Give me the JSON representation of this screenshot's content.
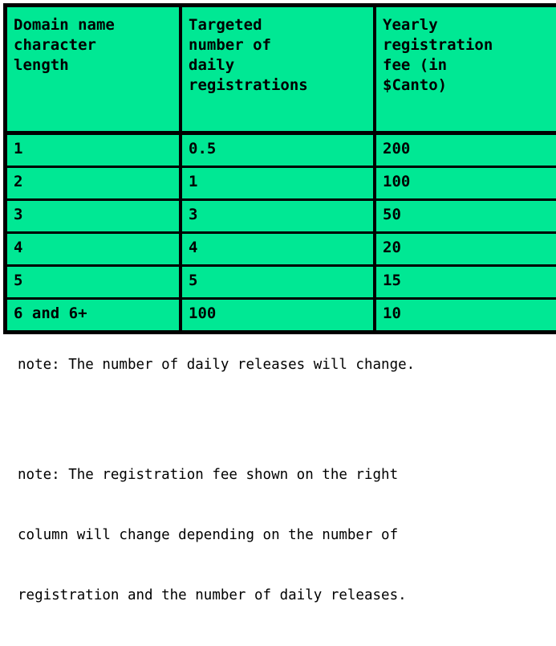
{
  "colors": {
    "cell_background": "#00e894",
    "border": "#000000",
    "text": "#000000",
    "page_background": "#ffffff"
  },
  "table": {
    "headers": [
      {
        "lines": [
          "Domain name",
          "character",
          "length"
        ]
      },
      {
        "lines": [
          "Targeted",
          "number of",
          "daily",
          "registrations"
        ]
      },
      {
        "lines": [
          "Yearly",
          "registration",
          "fee (in",
          "$Canto)"
        ]
      }
    ],
    "rows": [
      {
        "length": "1",
        "daily_registrations": "0.5",
        "yearly_fee": "200"
      },
      {
        "length": "2",
        "daily_registrations": "1",
        "yearly_fee": "100"
      },
      {
        "length": "3",
        "daily_registrations": "3",
        "yearly_fee": "50"
      },
      {
        "length": "4",
        "daily_registrations": "4",
        "yearly_fee": "20"
      },
      {
        "length": "5",
        "daily_registrations": "5",
        "yearly_fee": "15"
      },
      {
        "length": "6 and 6+",
        "daily_registrations": "100",
        "yearly_fee": "10"
      }
    ]
  },
  "notes": [
    {
      "lines": [
        "note: The number of daily releases will change."
      ]
    },
    {
      "lines": [
        "note: The registration fee shown on the right",
        "column will change depending on the number of",
        "registration and the number of daily releases."
      ]
    }
  ],
  "chart_data": {
    "type": "table",
    "title": "",
    "columns": [
      "Domain name character length",
      "Targeted number of daily registrations",
      "Yearly registration fee (in $Canto)"
    ],
    "rows": [
      [
        "1",
        "0.5",
        "200"
      ],
      [
        "2",
        "1",
        "100"
      ],
      [
        "3",
        "3",
        "50"
      ],
      [
        "4",
        "4",
        "20"
      ],
      [
        "5",
        "5",
        "15"
      ],
      [
        "6 and 6+",
        "100",
        "10"
      ]
    ],
    "numeric_rows": [
      {
        "length": 1,
        "daily_registrations": 0.5,
        "yearly_fee": 200
      },
      {
        "length": 2,
        "daily_registrations": 1,
        "yearly_fee": 100
      },
      {
        "length": 3,
        "daily_registrations": 3,
        "yearly_fee": 50
      },
      {
        "length": 4,
        "daily_registrations": 4,
        "yearly_fee": 20
      },
      {
        "length": 5,
        "daily_registrations": 5,
        "yearly_fee": 15
      },
      {
        "length": 6,
        "daily_registrations": 100,
        "yearly_fee": 10
      }
    ],
    "xlabel": "Domain name character length",
    "ylabel": "Yearly registration fee (in $Canto)",
    "grid": true,
    "legend": "none"
  }
}
